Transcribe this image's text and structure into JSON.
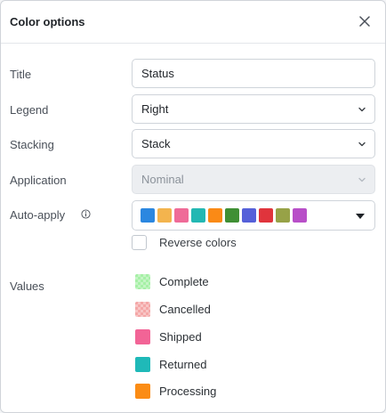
{
  "header": {
    "title": "Color options"
  },
  "fields": {
    "title": {
      "label": "Title",
      "value": "Status"
    },
    "legend": {
      "label": "Legend",
      "value": "Right"
    },
    "stacking": {
      "label": "Stacking",
      "value": "Stack"
    },
    "application": {
      "label": "Application",
      "value": "Nominal",
      "disabled": true
    },
    "auto_apply": {
      "label": "Auto-apply"
    }
  },
  "palette": [
    "#2b87e0",
    "#f3b44e",
    "#ef6b98",
    "#23b8b3",
    "#fa8a16",
    "#3f8f34",
    "#5560d9",
    "#e0343c",
    "#97a247",
    "#b84fc8"
  ],
  "reverse_colors": {
    "label": "Reverse colors",
    "checked": false
  },
  "values": {
    "label": "Values",
    "items": [
      {
        "label": "Complete",
        "color": "#a6f0a6",
        "pattern": true
      },
      {
        "label": "Cancelled",
        "color": "#f4a7a7",
        "pattern": true
      },
      {
        "label": "Shipped",
        "color": "#f26496",
        "pattern": false
      },
      {
        "label": "Returned",
        "color": "#1fb9b8",
        "pattern": false
      },
      {
        "label": "Processing",
        "color": "#fb8c15",
        "pattern": false
      }
    ]
  }
}
